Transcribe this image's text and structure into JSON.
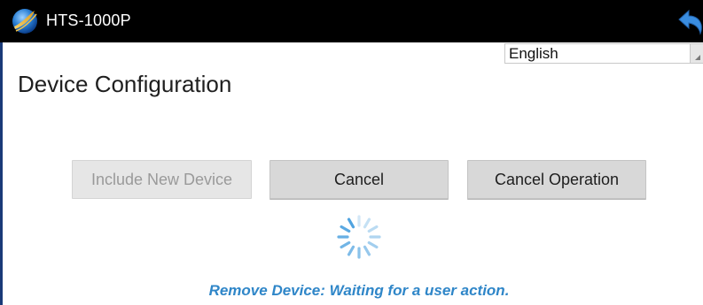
{
  "app": {
    "title": "HTS-1000P",
    "logo_icon": "globe-logo-icon",
    "back_icon": "back-arrow-icon"
  },
  "language": {
    "selected": "English"
  },
  "page": {
    "title": "Device Configuration"
  },
  "buttons": {
    "include_new_device": "Include New Device",
    "cancel": "Cancel",
    "cancel_operation": "Cancel Operation"
  },
  "status": {
    "message": "Remove Device: Waiting for a user action."
  },
  "colors": {
    "title_bar": "#000000",
    "status_text": "#2f86c8",
    "spinner": "#4fa3e0",
    "button_bg": "#d8d8d8"
  }
}
